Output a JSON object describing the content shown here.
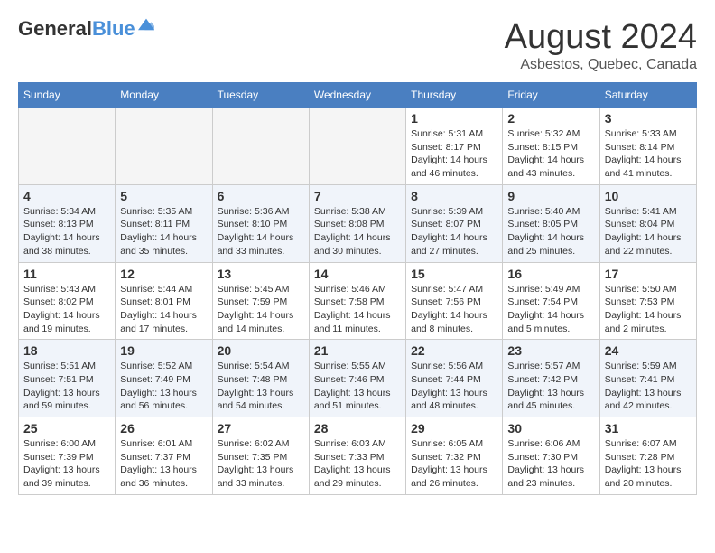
{
  "header": {
    "logo_line1": "General",
    "logo_line2": "Blue",
    "month_title": "August 2024",
    "subtitle": "Asbestos, Quebec, Canada"
  },
  "weekdays": [
    "Sunday",
    "Monday",
    "Tuesday",
    "Wednesday",
    "Thursday",
    "Friday",
    "Saturday"
  ],
  "weeks": [
    [
      {
        "day": "",
        "sunrise": "",
        "sunset": "",
        "daylight": "",
        "empty": true
      },
      {
        "day": "",
        "sunrise": "",
        "sunset": "",
        "daylight": "",
        "empty": true
      },
      {
        "day": "",
        "sunrise": "",
        "sunset": "",
        "daylight": "",
        "empty": true
      },
      {
        "day": "",
        "sunrise": "",
        "sunset": "",
        "daylight": "",
        "empty": true
      },
      {
        "day": "1",
        "sunrise": "5:31 AM",
        "sunset": "8:17 PM",
        "daylight": "14 hours and 46 minutes.",
        "empty": false
      },
      {
        "day": "2",
        "sunrise": "5:32 AM",
        "sunset": "8:15 PM",
        "daylight": "14 hours and 43 minutes.",
        "empty": false
      },
      {
        "day": "3",
        "sunrise": "5:33 AM",
        "sunset": "8:14 PM",
        "daylight": "14 hours and 41 minutes.",
        "empty": false
      }
    ],
    [
      {
        "day": "4",
        "sunrise": "5:34 AM",
        "sunset": "8:13 PM",
        "daylight": "14 hours and 38 minutes.",
        "empty": false
      },
      {
        "day": "5",
        "sunrise": "5:35 AM",
        "sunset": "8:11 PM",
        "daylight": "14 hours and 35 minutes.",
        "empty": false
      },
      {
        "day": "6",
        "sunrise": "5:36 AM",
        "sunset": "8:10 PM",
        "daylight": "14 hours and 33 minutes.",
        "empty": false
      },
      {
        "day": "7",
        "sunrise": "5:38 AM",
        "sunset": "8:08 PM",
        "daylight": "14 hours and 30 minutes.",
        "empty": false
      },
      {
        "day": "8",
        "sunrise": "5:39 AM",
        "sunset": "8:07 PM",
        "daylight": "14 hours and 27 minutes.",
        "empty": false
      },
      {
        "day": "9",
        "sunrise": "5:40 AM",
        "sunset": "8:05 PM",
        "daylight": "14 hours and 25 minutes.",
        "empty": false
      },
      {
        "day": "10",
        "sunrise": "5:41 AM",
        "sunset": "8:04 PM",
        "daylight": "14 hours and 22 minutes.",
        "empty": false
      }
    ],
    [
      {
        "day": "11",
        "sunrise": "5:43 AM",
        "sunset": "8:02 PM",
        "daylight": "14 hours and 19 minutes.",
        "empty": false
      },
      {
        "day": "12",
        "sunrise": "5:44 AM",
        "sunset": "8:01 PM",
        "daylight": "14 hours and 17 minutes.",
        "empty": false
      },
      {
        "day": "13",
        "sunrise": "5:45 AM",
        "sunset": "7:59 PM",
        "daylight": "14 hours and 14 minutes.",
        "empty": false
      },
      {
        "day": "14",
        "sunrise": "5:46 AM",
        "sunset": "7:58 PM",
        "daylight": "14 hours and 11 minutes.",
        "empty": false
      },
      {
        "day": "15",
        "sunrise": "5:47 AM",
        "sunset": "7:56 PM",
        "daylight": "14 hours and 8 minutes.",
        "empty": false
      },
      {
        "day": "16",
        "sunrise": "5:49 AM",
        "sunset": "7:54 PM",
        "daylight": "14 hours and 5 minutes.",
        "empty": false
      },
      {
        "day": "17",
        "sunrise": "5:50 AM",
        "sunset": "7:53 PM",
        "daylight": "14 hours and 2 minutes.",
        "empty": false
      }
    ],
    [
      {
        "day": "18",
        "sunrise": "5:51 AM",
        "sunset": "7:51 PM",
        "daylight": "13 hours and 59 minutes.",
        "empty": false
      },
      {
        "day": "19",
        "sunrise": "5:52 AM",
        "sunset": "7:49 PM",
        "daylight": "13 hours and 56 minutes.",
        "empty": false
      },
      {
        "day": "20",
        "sunrise": "5:54 AM",
        "sunset": "7:48 PM",
        "daylight": "13 hours and 54 minutes.",
        "empty": false
      },
      {
        "day": "21",
        "sunrise": "5:55 AM",
        "sunset": "7:46 PM",
        "daylight": "13 hours and 51 minutes.",
        "empty": false
      },
      {
        "day": "22",
        "sunrise": "5:56 AM",
        "sunset": "7:44 PM",
        "daylight": "13 hours and 48 minutes.",
        "empty": false
      },
      {
        "day": "23",
        "sunrise": "5:57 AM",
        "sunset": "7:42 PM",
        "daylight": "13 hours and 45 minutes.",
        "empty": false
      },
      {
        "day": "24",
        "sunrise": "5:59 AM",
        "sunset": "7:41 PM",
        "daylight": "13 hours and 42 minutes.",
        "empty": false
      }
    ],
    [
      {
        "day": "25",
        "sunrise": "6:00 AM",
        "sunset": "7:39 PM",
        "daylight": "13 hours and 39 minutes.",
        "empty": false
      },
      {
        "day": "26",
        "sunrise": "6:01 AM",
        "sunset": "7:37 PM",
        "daylight": "13 hours and 36 minutes.",
        "empty": false
      },
      {
        "day": "27",
        "sunrise": "6:02 AM",
        "sunset": "7:35 PM",
        "daylight": "13 hours and 33 minutes.",
        "empty": false
      },
      {
        "day": "28",
        "sunrise": "6:03 AM",
        "sunset": "7:33 PM",
        "daylight": "13 hours and 29 minutes.",
        "empty": false
      },
      {
        "day": "29",
        "sunrise": "6:05 AM",
        "sunset": "7:32 PM",
        "daylight": "13 hours and 26 minutes.",
        "empty": false
      },
      {
        "day": "30",
        "sunrise": "6:06 AM",
        "sunset": "7:30 PM",
        "daylight": "13 hours and 23 minutes.",
        "empty": false
      },
      {
        "day": "31",
        "sunrise": "6:07 AM",
        "sunset": "7:28 PM",
        "daylight": "13 hours and 20 minutes.",
        "empty": false
      }
    ]
  ],
  "labels": {
    "sunrise_prefix": "Sunrise: ",
    "sunset_prefix": "Sunset: ",
    "daylight_prefix": "Daylight: "
  }
}
